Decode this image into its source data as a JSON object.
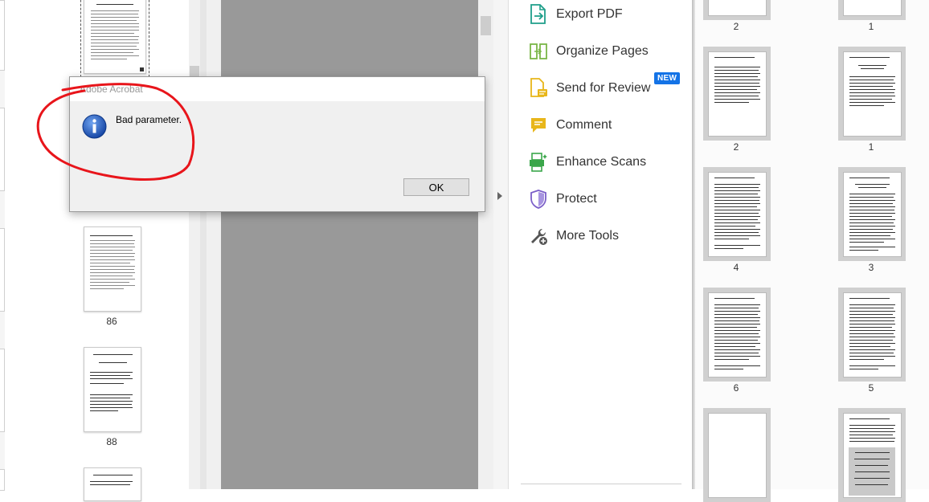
{
  "left_thumbnails": {
    "pages": [
      {
        "label": ""
      },
      {
        "label": "86"
      },
      {
        "label": "88"
      },
      {
        "label": ""
      }
    ]
  },
  "tools": {
    "items": [
      {
        "label": "Export PDF",
        "icon": "export-pdf-icon"
      },
      {
        "label": "Organize Pages",
        "icon": "organize-pages-icon"
      },
      {
        "label": "Send for Review",
        "icon": "send-for-review-icon"
      },
      {
        "label": "Comment",
        "icon": "comment-icon"
      },
      {
        "label": "Enhance Scans",
        "icon": "enhance-scans-icon"
      },
      {
        "label": "Protect",
        "icon": "protect-icon"
      },
      {
        "label": "More Tools",
        "icon": "more-tools-icon"
      }
    ],
    "new_badge": "NEW"
  },
  "right_thumbnails": {
    "pages": [
      "2",
      "1",
      "2",
      "1",
      "4",
      "3",
      "6",
      "5",
      "",
      ""
    ]
  },
  "dialog": {
    "title": "Adobe Acrobat",
    "message": "Bad parameter.",
    "ok_label": "OK",
    "icon": "info-icon"
  },
  "colors": {
    "annotation_circle": "#e8151b",
    "badge_blue": "#1473e6",
    "doc_area_gray": "#999999"
  }
}
